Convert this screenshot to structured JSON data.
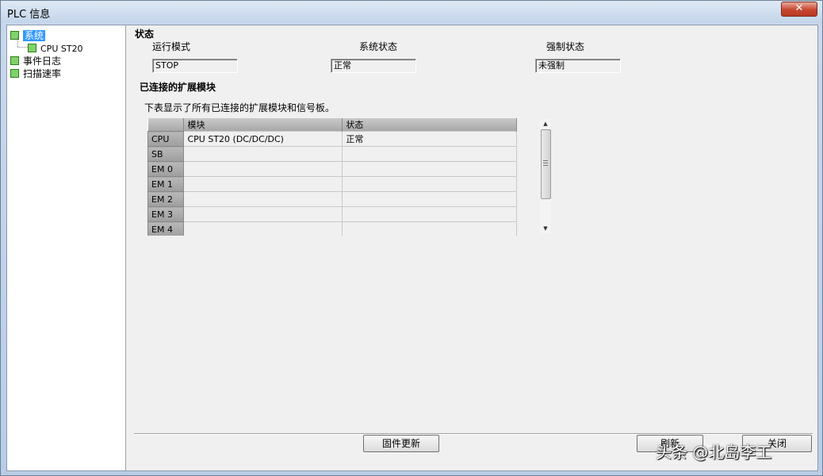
{
  "window": {
    "title": "PLC 信息",
    "close_glyph": "✕"
  },
  "tree": {
    "items": [
      {
        "label": "系统",
        "selected": true,
        "icon": "green-square-icon"
      },
      {
        "label": "CPU ST20",
        "icon": "green-square-icon"
      },
      {
        "label": "事件日志",
        "icon": "green-square-icon"
      },
      {
        "label": "扫描速率",
        "icon": "green-square-icon"
      }
    ]
  },
  "status": {
    "heading": "状态",
    "run_mode_label": "运行模式",
    "run_mode_value": "STOP",
    "system_status_label": "系统状态",
    "system_status_value": "正常",
    "force_status_label": "强制状态",
    "force_status_value": "未强制"
  },
  "modules": {
    "heading": "已连接的扩展模块",
    "description": "下表显示了所有已连接的扩展模块和信号板。",
    "columns": [
      "",
      "模块",
      "状态"
    ],
    "rows": [
      {
        "slot": "CPU",
        "module": "CPU ST20 (DC/DC/DC)",
        "status": "正常"
      },
      {
        "slot": "SB",
        "module": "",
        "status": ""
      },
      {
        "slot": "EM 0",
        "module": "",
        "status": ""
      },
      {
        "slot": "EM 1",
        "module": "",
        "status": ""
      },
      {
        "slot": "EM 2",
        "module": "",
        "status": ""
      },
      {
        "slot": "EM 3",
        "module": "",
        "status": ""
      },
      {
        "slot": "EM 4",
        "module": "",
        "status": ""
      }
    ]
  },
  "buttons": {
    "firmware_update": "固件更新",
    "refresh": "刷新",
    "close": "关闭"
  },
  "watermark": "头条 @北岛李工",
  "colors": {
    "selection": "#3399ff",
    "status_green": "#7fd36a",
    "close_red": "#c7462f"
  }
}
